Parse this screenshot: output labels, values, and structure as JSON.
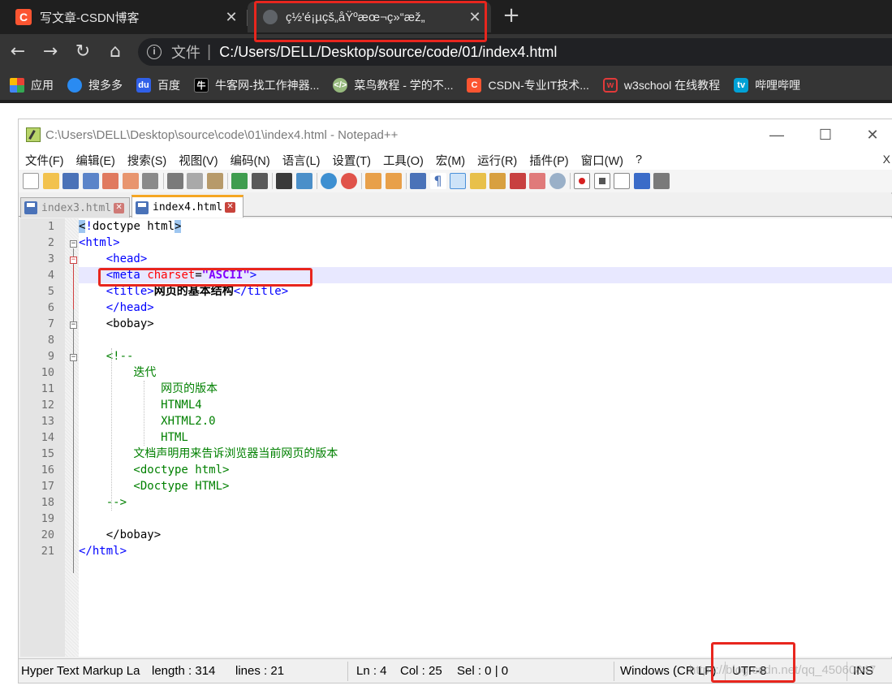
{
  "browser": {
    "tabs": [
      {
        "label": "写文章-CSDN博客",
        "icon": "csdn-icon",
        "active": false
      },
      {
        "label": "ç½'é¡µçš„åŸºæœ¬ç»“æž„",
        "icon": "globe-icon",
        "active": true
      }
    ],
    "address": {
      "scheme_label": "文件",
      "separator": "|",
      "url": "C:/Users/DELL/Desktop/source/code/01/index4.html"
    },
    "bookmarks": [
      {
        "label": "应用",
        "icon": "apps-grid-icon",
        "color": "#e94235"
      },
      {
        "label": "搜多多",
        "icon": "bird-icon",
        "color": "#2a8bf2"
      },
      {
        "label": "百度",
        "icon": "baidu-paw-icon",
        "color": "#3060e8"
      },
      {
        "label": "牛客网-找工作神器...",
        "icon": "nowcoder-icon",
        "color": "#000000"
      },
      {
        "label": "菜鸟教程 - 学的不...",
        "icon": "runoob-icon",
        "color": "#96b97d"
      },
      {
        "label": "CSDN-专业IT技术...",
        "icon": "csdn-icon",
        "color": "#fc5531"
      },
      {
        "label": "w3school 在线教程",
        "icon": "w3school-icon",
        "color": "#e23a3a"
      },
      {
        "label": "哔哩哔哩",
        "icon": "bilibili-icon",
        "color": "#00a1d6"
      }
    ]
  },
  "notepad": {
    "title": "C:\\Users\\DELL\\Desktop\\source\\code\\01\\index4.html - Notepad++",
    "window_controls": {
      "minimize": "—",
      "maximize": "☐",
      "close": "✕"
    },
    "menu": [
      "文件(F)",
      "编辑(E)",
      "搜索(S)",
      "视图(V)",
      "编码(N)",
      "语言(L)",
      "设置(T)",
      "工具(O)",
      "宏(M)",
      "运行(R)",
      "插件(P)",
      "窗口(W)",
      "?"
    ],
    "menu_close": "X",
    "file_tabs": [
      {
        "label": "index3.html",
        "active": false
      },
      {
        "label": "index4.html",
        "active": true
      }
    ],
    "code_lines": [
      "<!doctype html>",
      "<html>",
      "    <head>",
      "    <meta charset=\"ASCII\">",
      "    <title>网页的基本结构</title>",
      "    </head>",
      "    <bobay>",
      "",
      "    <!--",
      "        迭代",
      "            网页的版本",
      "            HTNML4",
      "            XHTML2.0",
      "            HTML",
      "        文档声明用来告诉浏览器当前网页的版本",
      "        <doctype html>",
      "        <Doctype HTML>",
      "    -->",
      "",
      "    </bobay>",
      "</html>"
    ],
    "status": {
      "language": "Hyper Text Markup La",
      "length": "length : 314",
      "lines": "lines : 21",
      "ln": "Ln : 4",
      "col": "Col : 25",
      "sel": "Sel : 0 | 0",
      "eol": "Windows (CR LF)",
      "encoding": "UTF-8",
      "mode": "INS"
    },
    "watermark": "https://blog.csdn.net/qq_45060847"
  },
  "colors": {
    "annotation_red": "#e8261e",
    "tag_blue": "#0000ff",
    "attr_red": "#ff0000",
    "value_purple": "#8000ff",
    "comment_green": "#008000"
  }
}
